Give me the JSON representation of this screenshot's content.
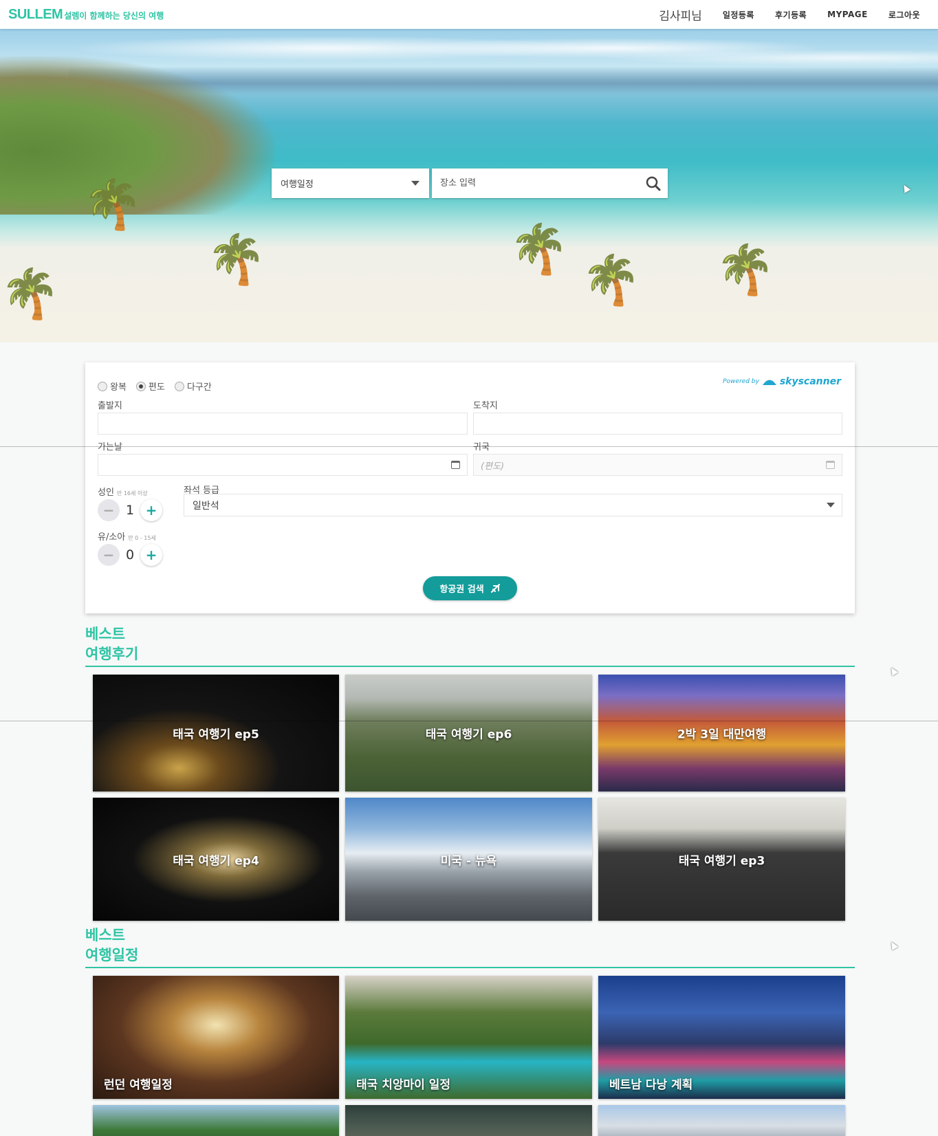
{
  "header": {
    "brand_name": "SULLEM",
    "brand_tagline": "설렘이 함께하는 당신의 여행",
    "user_name": "김사피님",
    "nav": [
      "일정등록",
      "후기등록",
      "MYPAGE",
      "로그아웃"
    ]
  },
  "hero": {
    "search_select": "여행일정",
    "search_placeholder": "장소 입력"
  },
  "flight": {
    "trip_types": [
      "왕복",
      "편도",
      "다구간"
    ],
    "selected_trip_type": "편도",
    "powered_by": "Powered by",
    "powered_brand": "skyscanner",
    "origin_label": "출발지",
    "destination_label": "도착지",
    "depart_label": "가는날",
    "return_label": "귀국",
    "return_value": "(편도)",
    "adult_label": "성인",
    "adult_sub": "만 16세 이상",
    "adult_count": "1",
    "child_label": "유/소아",
    "child_sub": "만 0 - 15세",
    "child_count": "0",
    "seat_label": "좌석 등급",
    "seat_value": "일반석",
    "search_button": "항공권 검색"
  },
  "best_reviews": {
    "title_line1": "베스트",
    "title_line2": "여행후기",
    "items": [
      "태국 여행기 ep5",
      "태국 여행기 ep6",
      "2박 3일 대만여행",
      "태국 여행기 ep4",
      "미국 - 뉴욕",
      "태국 여행기 ep3"
    ]
  },
  "best_plans": {
    "title_line1": "베스트",
    "title_line2": "여행일정",
    "items": [
      "런던 여행일정",
      "태국 치앙마이 일정",
      "베트남 다낭 계획"
    ]
  },
  "icons": {
    "search": "search-icon",
    "caret": "caret-down-icon",
    "calendar": "calendar-icon",
    "plane": "airplane-icon"
  },
  "colors": {
    "brand": "#2ec4a4",
    "button": "#139c9a",
    "accent_blue": "#20a6d0"
  }
}
